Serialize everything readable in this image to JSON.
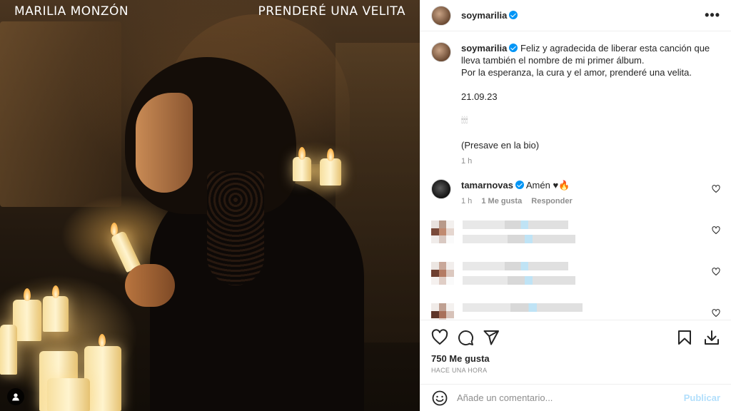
{
  "media": {
    "overlay_left": "MARILIA MONZÓN",
    "overlay_right": "PRENDERÉ UNA VELITA"
  },
  "header": {
    "username": "soymarilia",
    "more_label": "•••"
  },
  "caption": {
    "username": "soymarilia",
    "line1": "Feliz y agradecida de liberar esta canción que lleva también el nombre de mi primer álbum.",
    "line2": "Por la esperanza, la cura y el amor, prenderé una velita.",
    "date": "21.09.23",
    "emoji": "🕯🕯🕯",
    "presave": "(Presave en la bio)",
    "time": "1 h"
  },
  "comments": [
    {
      "username": "tamarnovas",
      "text": "Amén ♥🔥",
      "time": "1 h",
      "likes": "1 Me gusta",
      "reply": "Responder"
    }
  ],
  "stats": {
    "likes": "750 Me gusta",
    "time_ago": "HACE UNA HORA"
  },
  "composer": {
    "placeholder": "Añade un comentario...",
    "publish": "Publicar"
  },
  "colors": {
    "verified": "#0095f6",
    "publish_disabled": "#b2dffc"
  }
}
